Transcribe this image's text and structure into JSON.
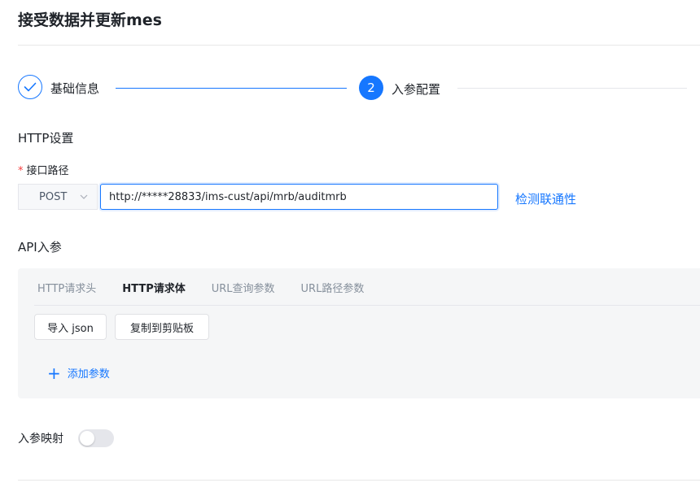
{
  "page": {
    "title": "接受数据并更新mes"
  },
  "steps": [
    {
      "label": "基础信息",
      "status": "done"
    },
    {
      "number": "2",
      "label": "入参配置",
      "status": "active"
    }
  ],
  "http_settings": {
    "title": "HTTP设置",
    "path_label": "接口路径",
    "required_mark": "*",
    "method": "POST",
    "url": "http://*****28833/ims-cust/api/mrb/auditmrb",
    "check_link": "检测联通性"
  },
  "api_params": {
    "title": "API入参",
    "tabs": [
      {
        "label": "HTTP请求头",
        "active": false
      },
      {
        "label": "HTTP请求体",
        "active": true
      },
      {
        "label": "URL查询参数",
        "active": false
      },
      {
        "label": "URL路径参数",
        "active": false
      }
    ],
    "import_button": "导入 json",
    "copy_button": "复制到剪贴板",
    "add_param": "添加参数"
  },
  "mapping": {
    "label": "入参映射",
    "enabled": false
  },
  "colors": {
    "accent": "#1677ff",
    "required": "#f53f3f",
    "panel_bg": "#f5f6f7"
  },
  "icons": {
    "step_done": "check-icon",
    "method_dropdown": "chevron-down-icon",
    "add": "plus-icon"
  }
}
